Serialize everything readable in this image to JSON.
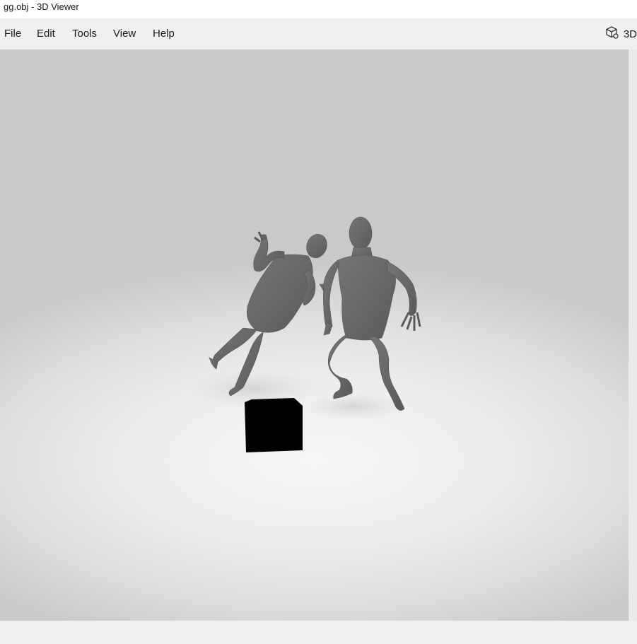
{
  "window": {
    "title": "gg.obj - 3D Viewer"
  },
  "menu": {
    "items": [
      {
        "label": "File"
      },
      {
        "label": "Edit"
      },
      {
        "label": "Tools"
      },
      {
        "label": "View"
      },
      {
        "label": "Help"
      }
    ]
  },
  "toolbar": {
    "mode_icon": "cube-icon",
    "mode_label": "3D"
  },
  "viewport": {
    "model": "two human figures",
    "object": "black box"
  },
  "colors": {
    "menubar_bg": "#f0f0f0",
    "figure_gray": "#646464",
    "box_black": "#000000"
  }
}
